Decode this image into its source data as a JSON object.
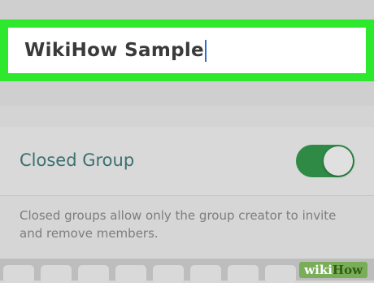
{
  "group_name_field": {
    "value": "WikiHow Sample"
  },
  "closed_group": {
    "label": "Closed Group",
    "enabled": true
  },
  "helper_text": "Closed groups allow only the group creator to invite and remove members.",
  "colors": {
    "highlight": "#2ee82e",
    "toggle_on": "#2e8a45",
    "label": "#3c6f70"
  },
  "watermark": {
    "prefix": "wiki",
    "suffix": "How"
  }
}
